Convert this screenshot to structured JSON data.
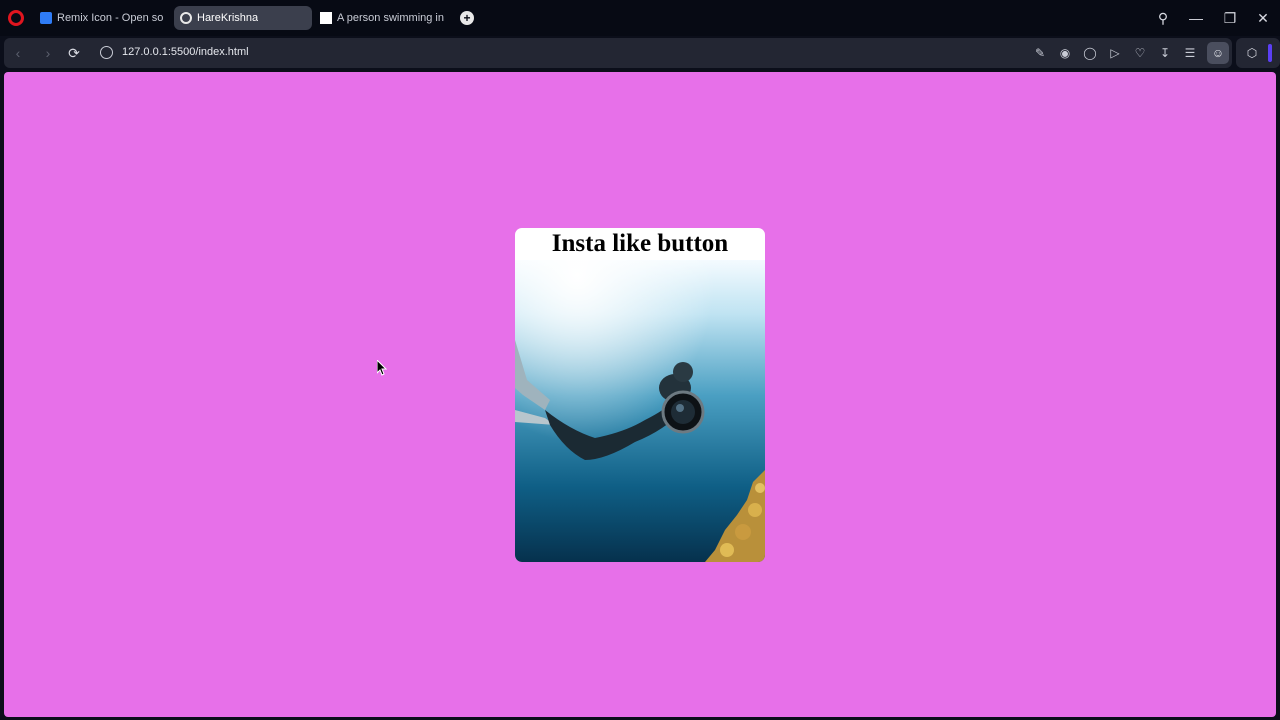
{
  "browser": {
    "tabs": [
      {
        "label": "Remix Icon - Open source",
        "icon": "remix-favicon",
        "active": false
      },
      {
        "label": "HareKrishna",
        "icon": "globe-icon",
        "active": true
      },
      {
        "label": "A person swimming in the",
        "icon": "unsplash-favicon",
        "active": false
      }
    ],
    "address": {
      "url": "127.0.0.1:5500/index.html"
    },
    "accent_color": "#5b3ff5"
  },
  "page": {
    "background_color": "#e770e9",
    "card": {
      "title": "Insta like button",
      "image_subject": "diver-with-camera-underwater"
    }
  }
}
